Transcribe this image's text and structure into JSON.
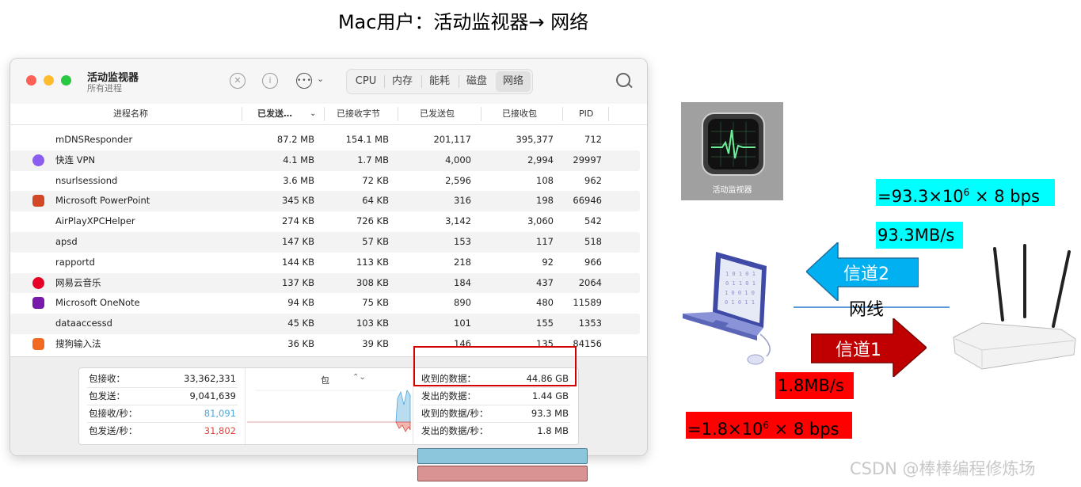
{
  "slide_title": "Mac用户：活动监视器→ 网络",
  "window": {
    "title": "活动监视器",
    "subtitle": "所有进程",
    "tabs": [
      "CPU",
      "内存",
      "能耗",
      "磁盘",
      "网络"
    ],
    "active_tab": "网络"
  },
  "columns": [
    "进程名称",
    "已发送…",
    "已接收字节",
    "已发送包",
    "已接收包",
    "PID"
  ],
  "rows": [
    {
      "name": "mDNSResponder",
      "sent_bytes": "87.2 MB",
      "recv_bytes": "154.1 MB",
      "sent_packets": "201,117",
      "recv_packets": "395,377",
      "pid": "712",
      "icon": "none"
    },
    {
      "name": "快连 VPN",
      "sent_bytes": "4.1 MB",
      "recv_bytes": "1.7 MB",
      "sent_packets": "4,000",
      "recv_packets": "2,994",
      "pid": "29997",
      "icon": "vpn-icon"
    },
    {
      "name": "nsurlsessiond",
      "sent_bytes": "3.6 MB",
      "recv_bytes": "72 KB",
      "sent_packets": "2,596",
      "recv_packets": "108",
      "pid": "962",
      "icon": "none"
    },
    {
      "name": "Microsoft PowerPoint",
      "sent_bytes": "345 KB",
      "recv_bytes": "64 KB",
      "sent_packets": "316",
      "recv_packets": "198",
      "pid": "66946",
      "icon": "powerpoint-icon"
    },
    {
      "name": "AirPlayXPCHelper",
      "sent_bytes": "274 KB",
      "recv_bytes": "726 KB",
      "sent_packets": "3,142",
      "recv_packets": "3,060",
      "pid": "542",
      "icon": "none"
    },
    {
      "name": "apsd",
      "sent_bytes": "147 KB",
      "recv_bytes": "57 KB",
      "sent_packets": "153",
      "recv_packets": "117",
      "pid": "518",
      "icon": "none"
    },
    {
      "name": "rapportd",
      "sent_bytes": "144 KB",
      "recv_bytes": "113 KB",
      "sent_packets": "218",
      "recv_packets": "92",
      "pid": "966",
      "icon": "none"
    },
    {
      "name": "网易云音乐",
      "sent_bytes": "137 KB",
      "recv_bytes": "308 KB",
      "sent_packets": "184",
      "recv_packets": "437",
      "pid": "2064",
      "icon": "netease-music-icon"
    },
    {
      "name": "Microsoft OneNote",
      "sent_bytes": "94 KB",
      "recv_bytes": "75 KB",
      "sent_packets": "890",
      "recv_packets": "480",
      "pid": "11589",
      "icon": "onenote-icon"
    },
    {
      "name": "dataaccessd",
      "sent_bytes": "45 KB",
      "recv_bytes": "103 KB",
      "sent_packets": "101",
      "recv_packets": "155",
      "pid": "1353",
      "icon": "none"
    },
    {
      "name": "搜狗输入法",
      "sent_bytes": "36 KB",
      "recv_bytes": "39 KB",
      "sent_packets": "146",
      "recv_packets": "135",
      "pid": "84156",
      "icon": "sogou-icon"
    }
  ],
  "stats_left": [
    {
      "label": "包接收：",
      "value": "33,362,331"
    },
    {
      "label": "包发送：",
      "value": "9,041,639"
    },
    {
      "label": "包接收/秒：",
      "value": "81,091"
    },
    {
      "label": "包发送/秒：",
      "value": "31,802"
    }
  ],
  "graph_title": "包",
  "stats_right": [
    {
      "label": "收到的数据：",
      "value": "44.86 GB"
    },
    {
      "label": "发出的数据：",
      "value": "1.44 GB"
    },
    {
      "label": "收到的数据/秒：",
      "value": "93.3 MB"
    },
    {
      "label": "发出的数据/秒：",
      "value": "1.8 MB"
    }
  ],
  "colors": {
    "received": "#4aa8e0",
    "sent": "#e0443a",
    "cyan_label": "#00ffff",
    "red_label": "#ff0000",
    "channel1": "#c00000",
    "channel2": "#00b0f0"
  },
  "icon_caption": "活动监视器",
  "annotations": {
    "recv_bps_prefix": "=93.3×10",
    "recv_bps_exp": "6",
    "recv_bps_suffix": " × 8 bps",
    "recv_rate": "93.3MB/s",
    "channel2": "信道2",
    "wire": "网线",
    "channel1": "信道1",
    "send_rate": "1.8MB/s",
    "send_bps_prefix": "=1.8×10",
    "send_bps_exp": "6",
    "send_bps_suffix": " × 8 bps"
  },
  "watermark": "CSDN @棒棒编程修炼场"
}
